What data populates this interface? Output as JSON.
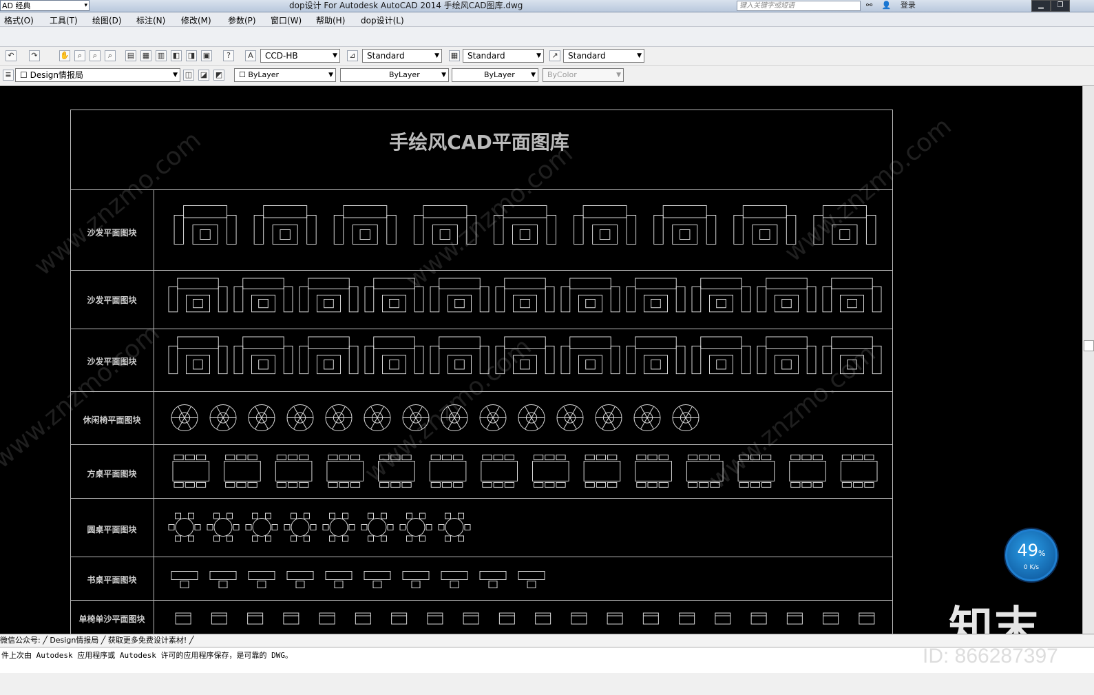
{
  "window": {
    "workspace": "AD 经典",
    "title": "dop设计 For Autodesk AutoCAD 2014    手绘风CAD图库.dwg",
    "search_placeholder": "键入关键字或短语",
    "login": "登录"
  },
  "menu": [
    "格式(O)",
    "工具(T)",
    "绘图(D)",
    "标注(N)",
    "修改(M)",
    "参数(P)",
    "窗口(W)",
    "帮助(H)",
    "dop设计(L)"
  ],
  "toolbar": {
    "text_style": "CCD-HB",
    "dim_style": "Standard",
    "table_style": "Standard",
    "multileader_style": "Standard",
    "layer": "Design情报局",
    "color": "ByLayer",
    "linetype": "ByLayer",
    "lineweight": "ByLayer",
    "plotstyle": "ByColor"
  },
  "drawing": {
    "title": "手绘风CAD平面图库",
    "rows": [
      {
        "label": "沙发平面图块",
        "count": 9
      },
      {
        "label": "沙发平面图块",
        "count": 11
      },
      {
        "label": "沙发平面图块",
        "count": 11
      },
      {
        "label": "休闲椅平面图块",
        "count": 14
      },
      {
        "label": "方桌平面图块",
        "count": 14
      },
      {
        "label": "圆桌平面图块",
        "count": 8
      },
      {
        "label": "书桌平面图块",
        "count": 10
      },
      {
        "label": "单椅单沙平面图块",
        "count": 20
      }
    ],
    "watermark": "www.znzmo.com"
  },
  "tabs": "微信公众号:  ╱ Design情报局 ╱ 获取更多免费设计素材! ╱",
  "status_line": "件上次由 Autodesk 应用程序或 Autodesk 许可的应用程序保存，是可靠的 DWG。",
  "overlay": {
    "gauge_pct": "49",
    "gauge_unit": "%",
    "gauge_speed": "0 K/s",
    "brand": "知末",
    "image_id": "ID: 866287397"
  }
}
